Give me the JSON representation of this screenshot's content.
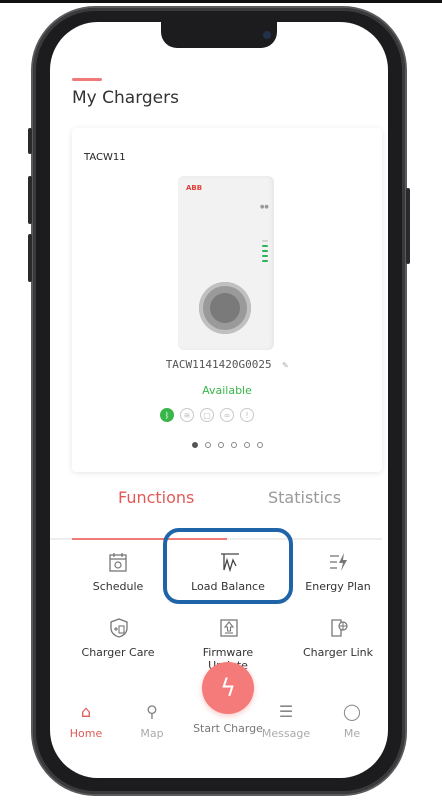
{
  "header": {
    "title": "My Chargers"
  },
  "charger_card": {
    "name": "TACW11",
    "brand": "ABB",
    "serial": "TACW1141420G0025",
    "edit_icon": "edit-icon",
    "status": "Available",
    "status_color": "#39b54a",
    "status_icons": [
      "bluetooth-icon",
      "wifi-icon",
      "lock-icon",
      "link-icon",
      "info-icon"
    ],
    "pager_count": 6,
    "pager_active": 0
  },
  "tabs": {
    "functions": "Functions",
    "statistics": "Statistics"
  },
  "functions": [
    {
      "label": "Schedule",
      "icon": "calendar-icon"
    },
    {
      "label": "Load Balance",
      "icon": "load-balance-icon"
    },
    {
      "label": "Energy Plan",
      "icon": "energy-plan-icon"
    },
    {
      "label": "Charger Care",
      "icon": "shield-icon"
    },
    {
      "label": "Firmware Update",
      "icon": "firmware-update-icon"
    },
    {
      "label": "Charger Link",
      "icon": "charger-link-icon"
    }
  ],
  "bottom_nav": {
    "home": "Home",
    "map": "Map",
    "start_charge": "Start Charge",
    "message": "Message",
    "me": "Me"
  },
  "colors": {
    "accent": "#f07a78",
    "highlight": "#1f64a8"
  }
}
